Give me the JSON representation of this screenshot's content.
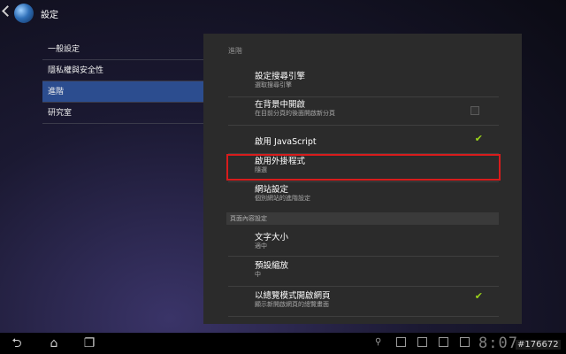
{
  "header": {
    "title": "設定",
    "icon": "globe-icon"
  },
  "sidebar": {
    "items": [
      {
        "label": "一般設定"
      },
      {
        "label": "隱私權與安全性"
      },
      {
        "label": "進階",
        "active": true
      },
      {
        "label": "研究室"
      }
    ]
  },
  "panel": {
    "header": "進階",
    "prefs": [
      {
        "title": "設定搜尋引擎",
        "sub": "選取搜尋引擎"
      },
      {
        "title": "在背景中開啟",
        "sub": "在目前分頁的後面開啟新分頁",
        "control": "checkbox",
        "checked": false
      },
      {
        "title": "啟用 JavaScript",
        "control": "checkbox",
        "checked": true
      },
      {
        "title": "啟用外掛程式",
        "sub": "隨選"
      },
      {
        "title": "網站設定",
        "sub": "個別網站的進階設定"
      }
    ],
    "section": "頁面內容設定",
    "content_prefs": [
      {
        "title": "文字大小",
        "sub": "適中"
      },
      {
        "title": "預設縮放",
        "sub": "中"
      },
      {
        "title": "以總覽模式開啟網頁",
        "sub": "顯示新開啟網頁的總覽畫面",
        "control": "checkbox",
        "checked": true
      }
    ]
  },
  "system_bar": {
    "buttons": [
      "back-icon",
      "home-icon",
      "recent-apps-icon"
    ],
    "clock": "8:07",
    "watermark": "#176672"
  },
  "colors": {
    "accent": "#2c4d8f",
    "check": "#9bd41a",
    "highlight": "#d81c1c"
  }
}
